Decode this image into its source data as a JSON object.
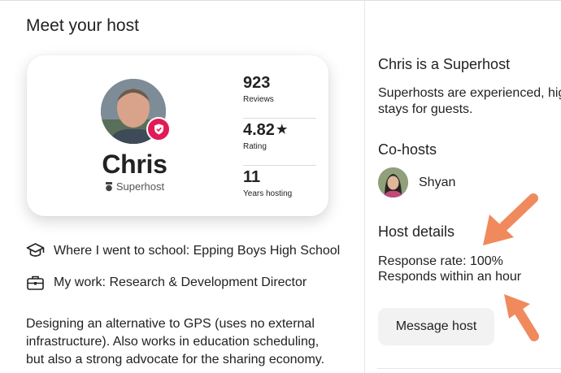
{
  "section_title": "Meet your host",
  "host": {
    "name": "Chris",
    "subtitle": "Superhost",
    "stats": [
      {
        "value": "923",
        "label": "Reviews"
      },
      {
        "value": "4.82",
        "label": "Rating",
        "star": "★"
      },
      {
        "value": "11",
        "label": "Years hosting"
      }
    ]
  },
  "details": {
    "school": "Where I went to school: Epping Boys High School",
    "work": "My work: Research & Development Director"
  },
  "bio": "Designing an alternative to GPS (uses no external infrastructure). Also works in education scheduling, but also a strong advocate for the sharing economy.",
  "superhost": {
    "heading": "Chris is a Superhost",
    "text_line1": "Superhosts are experienced, hig",
    "text_line2": "stays for guests."
  },
  "cohosts": {
    "heading": "Co-hosts",
    "items": [
      {
        "name": "Shyan"
      }
    ]
  },
  "host_details": {
    "heading": "Host details",
    "response_rate": "Response rate: 100%",
    "response_time": "Responds within an hour"
  },
  "message_button": "Message host",
  "colors": {
    "badge": "#e21a55",
    "annotation_arrow": "#f08a5d",
    "button_bg": "#f2f2f2"
  },
  "icons": {
    "badge": "shield-check-icon",
    "superhost": "medal-icon",
    "school": "graduation-cap-icon",
    "work": "briefcase-icon",
    "rating": "star-icon"
  }
}
